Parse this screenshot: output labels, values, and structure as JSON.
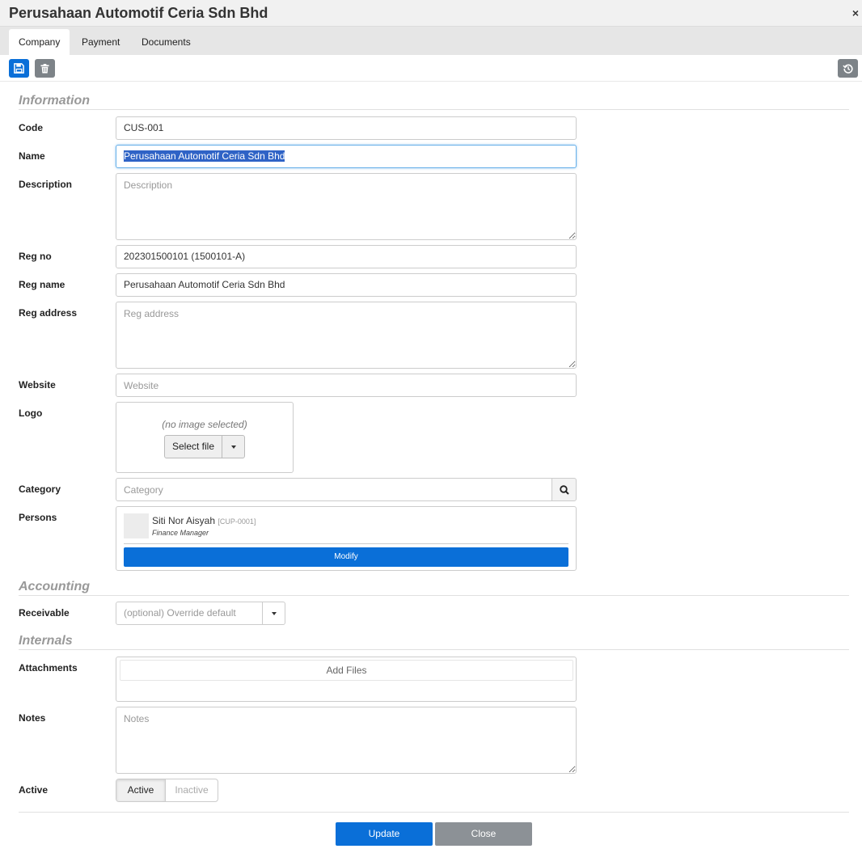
{
  "window": {
    "title": "Perusahaan Automotif Ceria Sdn Bhd",
    "close_glyph": "×"
  },
  "tabs": [
    {
      "label": "Company",
      "active": true
    },
    {
      "label": "Payment",
      "active": false
    },
    {
      "label": "Documents",
      "active": false
    }
  ],
  "toolbar": {
    "icons": [
      "save-icon",
      "trash-icon",
      "history-icon"
    ]
  },
  "sections": {
    "information": "Information",
    "accounting": "Accounting",
    "internals": "Internals"
  },
  "fields": {
    "code": {
      "label": "Code",
      "value": "CUS-001"
    },
    "name": {
      "label": "Name",
      "value": "Perusahaan Automotif Ceria Sdn Bhd"
    },
    "description": {
      "label": "Description",
      "value": "",
      "placeholder": "Description"
    },
    "reg_no": {
      "label": "Reg no",
      "value": "202301500101 (1500101-A)"
    },
    "reg_name": {
      "label": "Reg name",
      "value": "Perusahaan Automotif Ceria Sdn Bhd"
    },
    "reg_address": {
      "label": "Reg address",
      "value": "",
      "placeholder": "Reg address"
    },
    "website": {
      "label": "Website",
      "value": "",
      "placeholder": "Website"
    },
    "logo": {
      "label": "Logo",
      "empty_text": "(no image selected)",
      "button_label": "Select file"
    },
    "category": {
      "label": "Category",
      "value": "",
      "placeholder": "Category"
    },
    "persons": {
      "label": "Persons",
      "items": [
        {
          "name": "Siti Nor Aisyah",
          "code": "[CUP-0001]",
          "role": "Finance Manager"
        }
      ],
      "button_label": "Modify"
    },
    "receivable": {
      "label": "Receivable",
      "placeholder": "(optional) Override default"
    },
    "attachments": {
      "label": "Attachments",
      "button_label": "Add Files"
    },
    "notes": {
      "label": "Notes",
      "value": "",
      "placeholder": "Notes"
    },
    "active": {
      "label": "Active",
      "options": [
        "Active",
        "Inactive"
      ],
      "selected": "Active"
    }
  },
  "footer": {
    "update_label": "Update",
    "close_label": "Close"
  },
  "colors": {
    "primary": "#0a6fd8",
    "secondary": "#8c9196",
    "section_title": "#999999"
  }
}
